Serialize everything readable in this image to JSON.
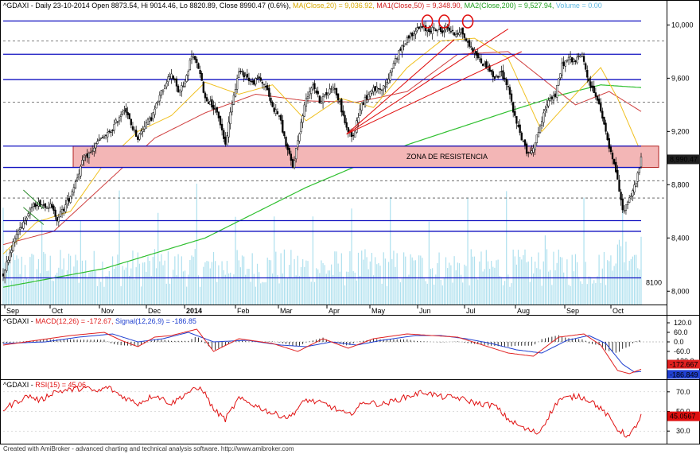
{
  "chart_data": [
    {
      "type": "candlestick",
      "title": {
        "symbol": "^GDAXI",
        "info": "- Daily 23-10-2014 Open 8873.54, Hi 9014.46, Lo 8820.89, Close 8990.47 (0.6%)",
        "ma": "MA(Close,20) = 9,036.92,",
        "ma1": "MA1(Close,50) = 9,348.90,",
        "ma2": "MA2(Close,200) = 9,527.94,",
        "volume": "Volume = 0.00"
      },
      "ylim": [
        7900,
        10080
      ],
      "y_ticks": [
        8000,
        8400,
        8800,
        9200,
        9600,
        10000
      ],
      "y_tick_labels": [
        "8,000",
        "8,400",
        "8,800",
        "9,200",
        "9,600",
        "10,000"
      ],
      "x_tick_labels": [
        "Sep",
        "Oct",
        "Nov",
        "Dec",
        "2014",
        "Feb",
        "Mar",
        "Apr",
        "May",
        "Jun",
        "Jul",
        "Aug",
        "Sep",
        "Oct"
      ],
      "last_price_label": "8,990.47",
      "zone_label": "ZONA DE RESISTENCIA",
      "zone_range": [
        8930,
        9090
      ],
      "support_label": "8100",
      "horizontal_levels_solid": [
        10030,
        9780,
        9590,
        9090,
        8930,
        8530,
        8450,
        8100
      ],
      "horizontal_levels_dashed": [
        9880,
        9420,
        8830,
        8700
      ],
      "close_anchors": [
        [
          0,
          8130
        ],
        [
          4,
          8290
        ],
        [
          8,
          8430
        ],
        [
          12,
          8520
        ],
        [
          16,
          8620
        ],
        [
          20,
          8660
        ],
        [
          24,
          8650
        ],
        [
          28,
          8640
        ],
        [
          32,
          8550
        ],
        [
          36,
          8620
        ],
        [
          40,
          8720
        ],
        [
          44,
          8860
        ],
        [
          48,
          9000
        ],
        [
          52,
          9040
        ],
        [
          56,
          9120
        ],
        [
          60,
          9160
        ],
        [
          64,
          9200
        ],
        [
          68,
          9290
        ],
        [
          72,
          9380
        ],
        [
          76,
          9250
        ],
        [
          80,
          9150
        ],
        [
          84,
          9250
        ],
        [
          88,
          9300
        ],
        [
          92,
          9430
        ],
        [
          96,
          9560
        ],
        [
          100,
          9640
        ],
        [
          104,
          9500
        ],
        [
          108,
          9560
        ],
        [
          112,
          9780
        ],
        [
          116,
          9680
        ],
        [
          120,
          9450
        ],
        [
          124,
          9400
        ],
        [
          128,
          9310
        ],
        [
          132,
          9100
        ],
        [
          136,
          9420
        ],
        [
          140,
          9650
        ],
        [
          144,
          9620
        ],
        [
          148,
          9560
        ],
        [
          152,
          9600
        ],
        [
          156,
          9540
        ],
        [
          160,
          9380
        ],
        [
          164,
          9320
        ],
        [
          168,
          9100
        ],
        [
          172,
          8930
        ],
        [
          176,
          9200
        ],
        [
          180,
          9450
        ],
        [
          184,
          9560
        ],
        [
          188,
          9430
        ],
        [
          192,
          9480
        ],
        [
          196,
          9550
        ],
        [
          200,
          9410
        ],
        [
          204,
          9220
        ],
        [
          208,
          9160
        ],
        [
          212,
          9380
        ],
        [
          216,
          9460
        ],
        [
          220,
          9530
        ],
        [
          224,
          9500
        ],
        [
          228,
          9560
        ],
        [
          232,
          9720
        ],
        [
          236,
          9810
        ],
        [
          240,
          9900
        ],
        [
          244,
          9950
        ],
        [
          248,
          9980
        ],
        [
          252,
          9960
        ],
        [
          256,
          9970
        ],
        [
          260,
          9950
        ],
        [
          264,
          9980
        ],
        [
          268,
          9930
        ],
        [
          272,
          9960
        ],
        [
          276,
          9860
        ],
        [
          280,
          9800
        ],
        [
          284,
          9720
        ],
        [
          288,
          9680
        ],
        [
          292,
          9600
        ],
        [
          296,
          9640
        ],
        [
          300,
          9540
        ],
        [
          304,
          9300
        ],
        [
          308,
          9150
        ],
        [
          312,
          9020
        ],
        [
          316,
          9120
        ],
        [
          320,
          9280
        ],
        [
          324,
          9450
        ],
        [
          328,
          9470
        ],
        [
          332,
          9700
        ],
        [
          336,
          9750
        ],
        [
          340,
          9730
        ],
        [
          344,
          9780
        ],
        [
          348,
          9560
        ],
        [
          352,
          9480
        ],
        [
          356,
          9300
        ],
        [
          360,
          9080
        ],
        [
          364,
          8900
        ],
        [
          368,
          8600
        ],
        [
          372,
          8700
        ],
        [
          376,
          8820
        ],
        [
          379,
          8990
        ]
      ],
      "ma20_anchors": [
        [
          0,
          8280
        ],
        [
          20,
          8520
        ],
        [
          40,
          8600
        ],
        [
          60,
          8960
        ],
        [
          80,
          9200
        ],
        [
          100,
          9320
        ],
        [
          120,
          9570
        ],
        [
          140,
          9480
        ],
        [
          160,
          9550
        ],
        [
          180,
          9280
        ],
        [
          200,
          9450
        ],
        [
          220,
          9380
        ],
        [
          240,
          9680
        ],
        [
          260,
          9880
        ],
        [
          280,
          9900
        ],
        [
          300,
          9750
        ],
        [
          320,
          9200
        ],
        [
          340,
          9480
        ],
        [
          355,
          9680
        ],
        [
          365,
          9450
        ],
        [
          379,
          9040
        ]
      ],
      "ma50_anchors": [
        [
          0,
          8350
        ],
        [
          30,
          8450
        ],
        [
          60,
          8800
        ],
        [
          90,
          9150
        ],
        [
          120,
          9340
        ],
        [
          150,
          9480
        ],
        [
          180,
          9430
        ],
        [
          210,
          9420
        ],
        [
          240,
          9500
        ],
        [
          270,
          9780
        ],
        [
          300,
          9800
        ],
        [
          320,
          9600
        ],
        [
          340,
          9400
        ],
        [
          360,
          9500
        ],
        [
          379,
          9350
        ]
      ],
      "ma200_anchors": [
        [
          0,
          8030
        ],
        [
          60,
          8170
        ],
        [
          120,
          8400
        ],
        [
          180,
          8780
        ],
        [
          240,
          9100
        ],
        [
          300,
          9350
        ],
        [
          330,
          9470
        ],
        [
          355,
          9550
        ],
        [
          379,
          9530
        ]
      ],
      "trendlines": [
        {
          "from": [
            12,
            8760
          ],
          "to": [
            24,
            8620
          ],
          "color": "#2a8a2a"
        },
        {
          "from": [
            12,
            8630
          ],
          "to": [
            24,
            8500
          ],
          "color": "#2a8a2a"
        },
        {
          "from": [
            204,
            9180
          ],
          "to": [
            268,
            9890
          ],
          "color": "#e01010"
        },
        {
          "from": [
            204,
            9180
          ],
          "to": [
            300,
            9970
          ],
          "color": "#e01010"
        },
        {
          "from": [
            204,
            9180
          ],
          "to": [
            308,
            9800
          ],
          "color": "#e01010"
        }
      ],
      "circled_tops": [
        252,
        262,
        276
      ],
      "colors": {
        "up": "#000000",
        "down": "#000000",
        "volume": "#aee0ee",
        "ma20": "#f0c020",
        "ma50": "#d04040",
        "ma200": "#30c030",
        "level": "#1010c0",
        "zone_fill": "#f3b6b6",
        "zone_edge": "#b02020",
        "label_bg": "#202020",
        "label_text": "#ffffff"
      }
    },
    {
      "type": "line",
      "title": {
        "symbol": "^GDAXI",
        "macd": "MACD(12,26) = -172.67,",
        "signal": "Signal(12,26,9) = -186.85"
      },
      "ylim": [
        -230,
        160
      ],
      "y_ticks": [
        120,
        60,
        0,
        -60,
        -120
      ],
      "y_tick_labels": [
        "120.0",
        "60.0",
        "0.0",
        "-60.0",
        "-120.0"
      ],
      "last_labels": [
        "-172.667",
        "-186.849"
      ],
      "macd_anchors": [
        [
          0,
          -20
        ],
        [
          20,
          10
        ],
        [
          40,
          40
        ],
        [
          60,
          60
        ],
        [
          70,
          10
        ],
        [
          80,
          -30
        ],
        [
          90,
          30
        ],
        [
          100,
          40
        ],
        [
          115,
          80
        ],
        [
          125,
          -60
        ],
        [
          140,
          20
        ],
        [
          160,
          -10
        ],
        [
          175,
          -60
        ],
        [
          190,
          20
        ],
        [
          205,
          -40
        ],
        [
          220,
          20
        ],
        [
          240,
          50
        ],
        [
          255,
          40
        ],
        [
          270,
          30
        ],
        [
          285,
          -20
        ],
        [
          300,
          -70
        ],
        [
          315,
          -90
        ],
        [
          330,
          30
        ],
        [
          345,
          50
        ],
        [
          355,
          -20
        ],
        [
          365,
          -180
        ],
        [
          372,
          -200
        ],
        [
          379,
          -172
        ]
      ],
      "signal_anchors": [
        [
          0,
          -10
        ],
        [
          25,
          0
        ],
        [
          45,
          30
        ],
        [
          65,
          50
        ],
        [
          80,
          0
        ],
        [
          95,
          20
        ],
        [
          110,
          60
        ],
        [
          125,
          0
        ],
        [
          145,
          10
        ],
        [
          165,
          -20
        ],
        [
          180,
          -30
        ],
        [
          195,
          0
        ],
        [
          210,
          -20
        ],
        [
          225,
          10
        ],
        [
          245,
          40
        ],
        [
          260,
          40
        ],
        [
          275,
          20
        ],
        [
          290,
          -10
        ],
        [
          305,
          -50
        ],
        [
          320,
          -70
        ],
        [
          335,
          10
        ],
        [
          348,
          40
        ],
        [
          358,
          -10
        ],
        [
          368,
          -140
        ],
        [
          375,
          -190
        ],
        [
          379,
          -186
        ]
      ],
      "colors": {
        "macd": "#e02020",
        "signal": "#2040d0",
        "hist": "#000000",
        "label_macd": "#e02020",
        "label_signal": "#2040d0"
      }
    },
    {
      "type": "line",
      "title": {
        "symbol": "^GDAXI",
        "rsi": "RSI(15) = 45.06"
      },
      "ylim": [
        18,
        82
      ],
      "y_ticks": [
        70,
        50,
        30
      ],
      "y_tick_labels": [
        "70.0",
        "50.0",
        "30.0"
      ],
      "last_label": "45.0567",
      "rsi_anchors": [
        [
          0,
          52
        ],
        [
          8,
          60
        ],
        [
          15,
          66
        ],
        [
          22,
          61
        ],
        [
          30,
          70
        ],
        [
          40,
          72
        ],
        [
          48,
          74
        ],
        [
          56,
          70
        ],
        [
          62,
          75
        ],
        [
          70,
          66
        ],
        [
          80,
          58
        ],
        [
          90,
          67
        ],
        [
          100,
          58
        ],
        [
          110,
          70
        ],
        [
          118,
          74
        ],
        [
          125,
          52
        ],
        [
          132,
          42
        ],
        [
          140,
          63
        ],
        [
          150,
          56
        ],
        [
          160,
          48
        ],
        [
          170,
          44
        ],
        [
          180,
          62
        ],
        [
          192,
          57
        ],
        [
          205,
          46
        ],
        [
          215,
          60
        ],
        [
          225,
          57
        ],
        [
          240,
          65
        ],
        [
          250,
          70
        ],
        [
          260,
          65
        ],
        [
          270,
          64
        ],
        [
          282,
          58
        ],
        [
          292,
          56
        ],
        [
          300,
          42
        ],
        [
          310,
          32
        ],
        [
          318,
          28
        ],
        [
          330,
          62
        ],
        [
          342,
          66
        ],
        [
          350,
          60
        ],
        [
          358,
          48
        ],
        [
          365,
          32
        ],
        [
          372,
          24
        ],
        [
          379,
          45
        ]
      ],
      "colors": {
        "rsi": "#e01010",
        "label": "#e01010"
      }
    }
  ],
  "footer": "Created with AmiBroker - advanced charting and technical analysis software. http://www.amibroker.com"
}
